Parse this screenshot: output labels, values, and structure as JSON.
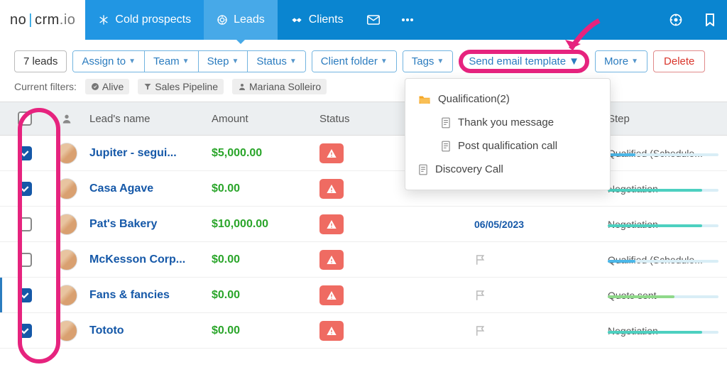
{
  "logo": {
    "part1": "no",
    "bar": "|",
    "part2": "crm",
    "io": ".io"
  },
  "nav": {
    "cold": "Cold prospects",
    "leads": "Leads",
    "clients": "Clients"
  },
  "toolbar": {
    "count": "7 leads",
    "assign": "Assign to",
    "team": "Team",
    "step": "Step",
    "status": "Status",
    "client_folder": "Client folder",
    "tags": "Tags",
    "send_email": "Send email template",
    "more": "More",
    "delete": "Delete"
  },
  "filters": {
    "label": "Current filters:",
    "alive": "Alive",
    "pipeline": "Sales Pipeline",
    "user": "Mariana Solleiro"
  },
  "columns": {
    "name": "Lead's name",
    "amount": "Amount",
    "status": "Status",
    "step": "Step"
  },
  "dropdown": {
    "folder": "Qualification(2)",
    "item1": "Thank you message",
    "item2": "Post qualification call",
    "item3": "Discovery Call"
  },
  "rows": [
    {
      "checked": true,
      "name": "Jupiter - segui...",
      "amount": "$5,000.00",
      "date": "",
      "flag": false,
      "step": "Qualified (Schedule...",
      "bar_color": "#4bb7e8",
      "bar_pct": 25
    },
    {
      "checked": true,
      "name": "Casa Agave",
      "amount": "$0.00",
      "date": "",
      "flag": false,
      "step": "Negotiation",
      "bar_color": "#4dd0c0",
      "bar_pct": 85
    },
    {
      "checked": false,
      "name": "Pat's Bakery",
      "amount": "$10,000.00",
      "date": "06/05/2023",
      "flag": false,
      "step": "Negotiation",
      "bar_color": "#4dd0c0",
      "bar_pct": 85
    },
    {
      "checked": false,
      "name": "McKesson Corp...",
      "amount": "$0.00",
      "date": "",
      "flag": true,
      "step": "Qualified (Schedule...",
      "bar_color": "#4bb7e8",
      "bar_pct": 25
    },
    {
      "checked": true,
      "name": "Fans & fancies",
      "amount": "$0.00",
      "date": "",
      "flag": true,
      "step": "Quote sent",
      "bar_color": "#8fd98a",
      "bar_pct": 60,
      "edge": true
    },
    {
      "checked": true,
      "name": "Tototo",
      "amount": "$0.00",
      "date": "",
      "flag": true,
      "step": "Negotiation",
      "bar_color": "#4dd0c0",
      "bar_pct": 85
    }
  ]
}
